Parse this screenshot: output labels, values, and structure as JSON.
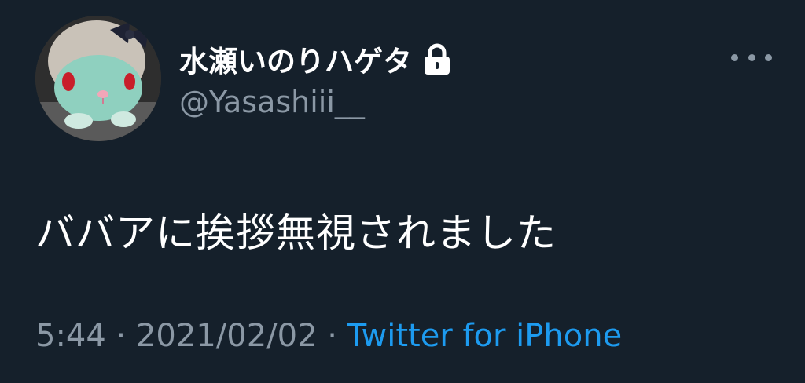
{
  "tweet": {
    "author": {
      "display_name": "水瀬いのりハゲタ",
      "handle": "@Yasashiii__",
      "protected_icon": "lock-icon",
      "avatar": "plush-bunny-avatar"
    },
    "more_icon": "more-dots-icon",
    "text": "ババアに挨拶無視されました",
    "meta": {
      "time": "5:44",
      "separator": "·",
      "date": "2021/02/02",
      "source": "Twitter for iPhone"
    }
  },
  "colors": {
    "background": "#15202b",
    "primary_text": "#ffffff",
    "secondary_text": "#8b98a5",
    "link": "#1d9bf0"
  }
}
